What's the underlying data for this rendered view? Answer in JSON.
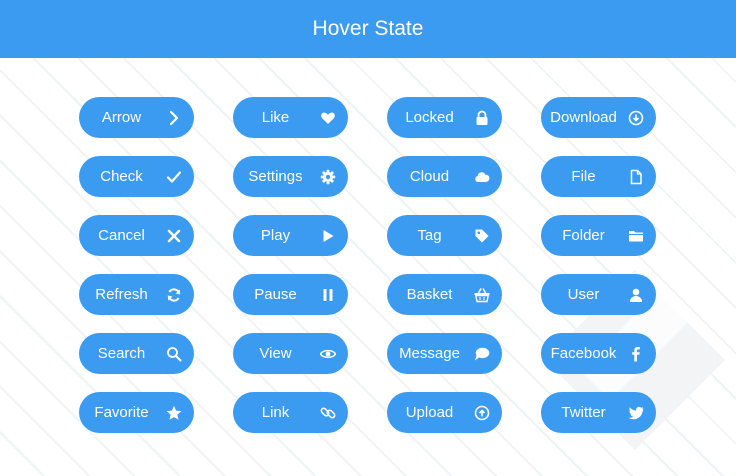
{
  "header": {
    "title": "Hover State"
  },
  "colors": {
    "accent": "#3a9bf1",
    "text": "#ffffff",
    "background": "#ffffff"
  },
  "buttons": [
    [
      {
        "label": "Arrow",
        "icon": "chevron-right-icon"
      },
      {
        "label": "Like",
        "icon": "heart-icon"
      },
      {
        "label": "Locked",
        "icon": "lock-icon"
      },
      {
        "label": "Download",
        "icon": "download-circle-icon"
      }
    ],
    [
      {
        "label": "Check",
        "icon": "check-icon"
      },
      {
        "label": "Settings",
        "icon": "gear-icon"
      },
      {
        "label": "Cloud",
        "icon": "cloud-icon"
      },
      {
        "label": "File",
        "icon": "file-icon"
      }
    ],
    [
      {
        "label": "Cancel",
        "icon": "close-icon"
      },
      {
        "label": "Play",
        "icon": "play-icon"
      },
      {
        "label": "Tag",
        "icon": "tag-icon"
      },
      {
        "label": "Folder",
        "icon": "folder-icon"
      }
    ],
    [
      {
        "label": "Refresh",
        "icon": "refresh-icon"
      },
      {
        "label": "Pause",
        "icon": "pause-icon"
      },
      {
        "label": "Basket",
        "icon": "basket-icon"
      },
      {
        "label": "User",
        "icon": "user-icon"
      }
    ],
    [
      {
        "label": "Search",
        "icon": "search-icon"
      },
      {
        "label": "View",
        "icon": "eye-icon"
      },
      {
        "label": "Message",
        "icon": "chat-bubble-icon"
      },
      {
        "label": "Facebook",
        "icon": "facebook-icon"
      }
    ],
    [
      {
        "label": "Favorite",
        "icon": "star-icon"
      },
      {
        "label": "Link",
        "icon": "link-icon"
      },
      {
        "label": "Upload",
        "icon": "upload-circle-icon"
      },
      {
        "label": "Twitter",
        "icon": "twitter-icon"
      }
    ]
  ]
}
